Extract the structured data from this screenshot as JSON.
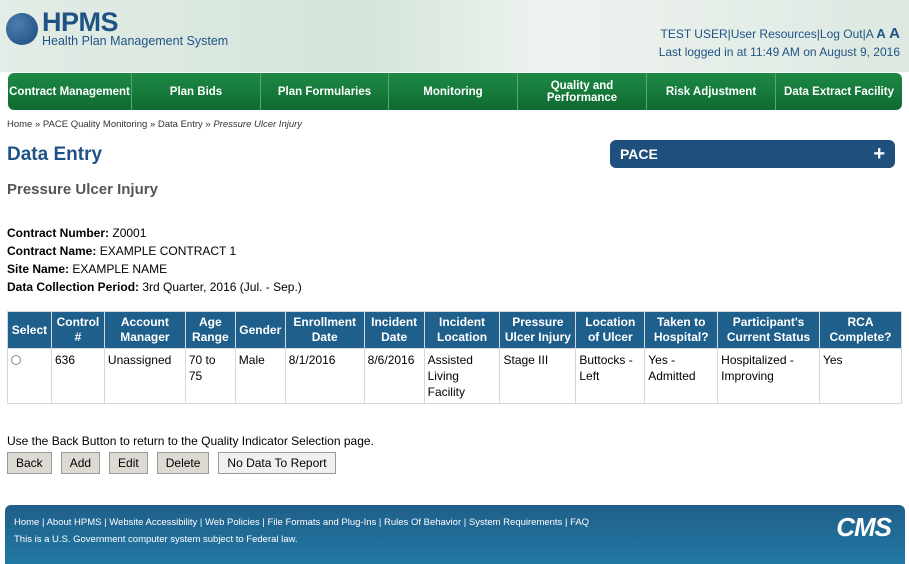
{
  "header": {
    "logo_title": "HPMS",
    "logo_subtitle": "Health Plan Management System",
    "user": "TEST USER",
    "user_resources": "User Resources",
    "logout": "Log Out",
    "font_small": "A",
    "font_medium": "A",
    "font_large": "A",
    "last_login": "Last logged in at 11:49 AM on August 9, 2016"
  },
  "nav": [
    "Contract Management",
    "Plan Bids",
    "Plan Formularies",
    "Monitoring",
    "Quality and Performance",
    "Risk Adjustment",
    "Data Extract Facility"
  ],
  "breadcrumb": {
    "items": [
      "Home",
      "PACE Quality Monitoring",
      "Data Entry"
    ],
    "current": "Pressure Ulcer Injury",
    "separator": "»"
  },
  "page": {
    "title": "Data Entry",
    "subtitle": "Pressure Ulcer Injury",
    "pace_label": "PACE",
    "pace_toggle": "+"
  },
  "info": [
    {
      "label": "Contract Number:",
      "value": "Z0001"
    },
    {
      "label": "Contract Name:",
      "value": "EXAMPLE CONTRACT 1"
    },
    {
      "label": "Site Name:",
      "value": "EXAMPLE NAME"
    },
    {
      "label": "Data Collection Period:",
      "value": "3rd Quarter, 2016 (Jul. - Sep.)"
    }
  ],
  "table": {
    "headers": [
      "Select",
      "Control #",
      "Account Manager",
      "Age Range",
      "Gender",
      "Enrollment Date",
      "Incident Date",
      "Incident Location",
      "Pressure Ulcer Injury",
      "Location of Ulcer",
      "Taken to Hospital?",
      "Participant's Current Status",
      "RCA Complete?"
    ],
    "rows": [
      [
        "",
        "636",
        "Unassigned",
        "70 to 75",
        "Male",
        "8/1/2016",
        "8/6/2016",
        "Assisted Living Facility",
        "Stage III",
        "Buttocks - Left",
        "Yes - Admitted",
        "Hospitalized - Improving",
        "Yes"
      ]
    ]
  },
  "note": "Use the Back Button to return to the Quality Indicator Selection page.",
  "buttons": {
    "back": "Back",
    "add": "Add",
    "edit": "Edit",
    "delete": "Delete",
    "no_data": "No Data To Report"
  },
  "footer": {
    "links": [
      "Home",
      "About HPMS",
      "Website Accessibility",
      "Web Policies",
      "File Formats and Plug-Ins",
      "Rules Of Behavior",
      "System Requirements",
      "FAQ"
    ],
    "notice": "This is a U.S. Government computer system subject to Federal law.",
    "logo": "CMS"
  }
}
